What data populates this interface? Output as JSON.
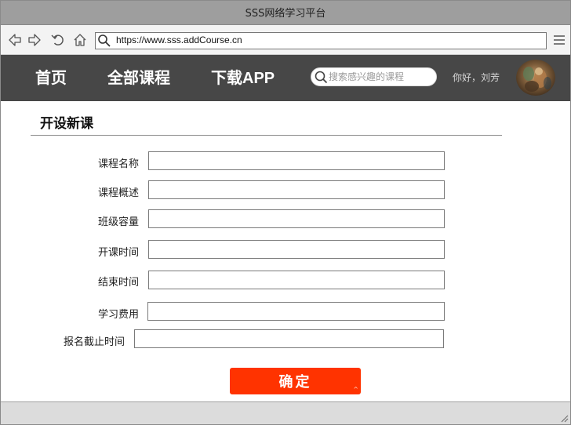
{
  "window": {
    "title": "SSS网络学习平台"
  },
  "browser": {
    "url": "https://www.sss.addCourse.cn",
    "icons": [
      "back-arrow-icon",
      "forward-arrow-icon",
      "reload-icon",
      "home-icon",
      "search-icon",
      "menu-icon"
    ]
  },
  "site": {
    "nav": {
      "home": "首页",
      "all_courses": "全部课程",
      "download_app": "下载APP"
    },
    "search": {
      "placeholder": "搜索感兴趣的课程"
    },
    "greeting": "你好，刘芳"
  },
  "form": {
    "title": "开设新课",
    "fields": {
      "course_name": {
        "label": "课程名称",
        "value": ""
      },
      "course_summary": {
        "label": "课程概述",
        "value": ""
      },
      "class_capacity": {
        "label": "班级容量",
        "value": ""
      },
      "start_time": {
        "label": "开课时间",
        "value": ""
      },
      "end_time": {
        "label": "结束时间",
        "value": ""
      },
      "tuition": {
        "label": "学习费用",
        "value": ""
      },
      "signup_deadline": {
        "label": "报名截止时间",
        "value": ""
      }
    },
    "submit_label": "确定"
  },
  "colors": {
    "title_bar": "#9e9e9e",
    "header_bg": "#474747",
    "submit_bg": "#ff3300",
    "status_bar": "#dcdcdc"
  }
}
